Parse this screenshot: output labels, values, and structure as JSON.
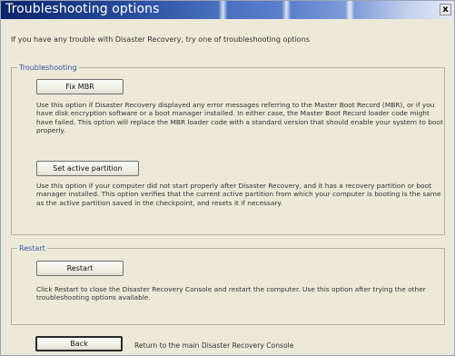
{
  "window": {
    "title": "Troubleshooting options",
    "close_glyph": "x"
  },
  "intro_text": "If you have any trouble with Disaster Recovery, try one of troubleshooting options",
  "troubleshooting": {
    "legend": "Troubleshooting",
    "fix_mbr_label": "Fix MBR",
    "fix_mbr_desc": "Use this option if Disaster Recovery displayed any error messages referring to the Master Boot Record (MBR), or if you have disk encryption software or a boot manager installed. In either case, the Master Boot Record loader code might have failed. This option will replace the MBR loader code with a standard version that should enable your system to boot properly.",
    "set_active_label": "Set active partition",
    "set_active_desc": "Use this option if your computer did not start properly after Disaster Recovery, and it has a recovery partition or boot manager installed. This option verifies that the current active partition from which your computer is booting is the same as the active partition saved in the checkpoint, and resets it if necessary."
  },
  "restart": {
    "legend": "Restart",
    "button_label": "Restart",
    "desc": "Click Restart to close the Disaster Recovery Console and restart the computer. Use this option after trying the other troubleshooting options available."
  },
  "back": {
    "button_label": "Back",
    "desc": "Return to the main Disaster Recovery Console"
  },
  "colors": {
    "title_bar_dark": "#0a246a",
    "group_title": "#3355aa",
    "background": "#ece9d8"
  }
}
